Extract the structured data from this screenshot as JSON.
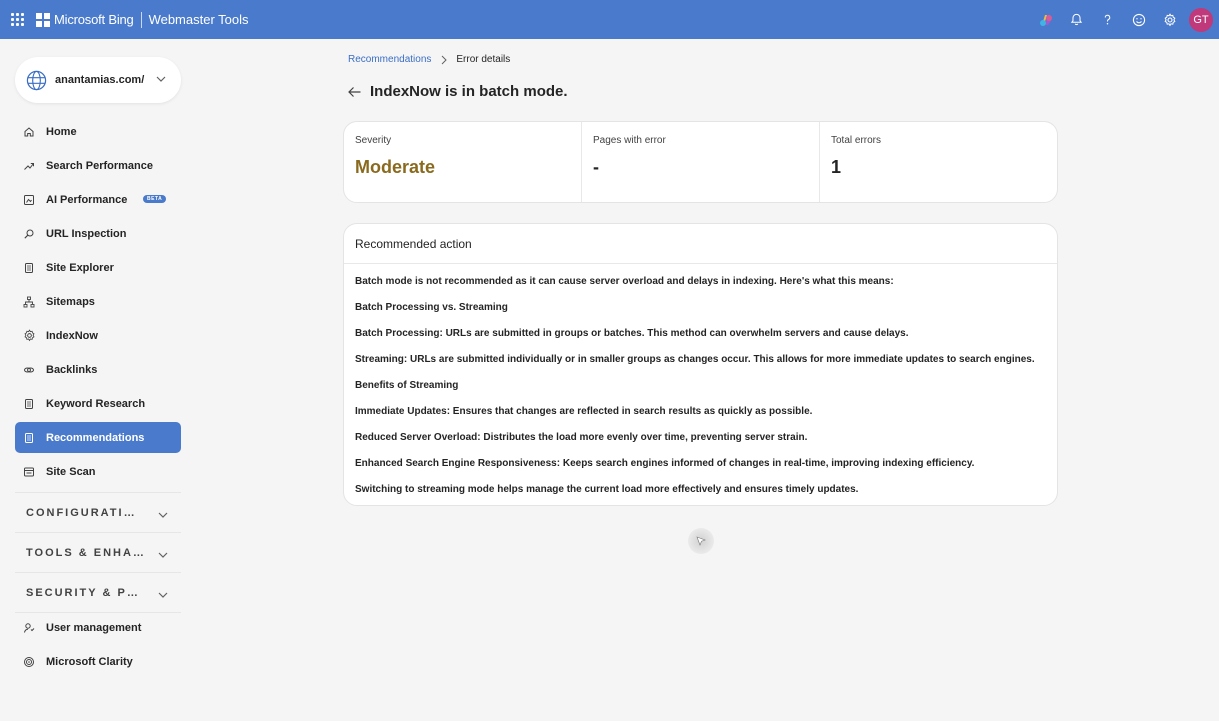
{
  "topbar": {
    "brand": "Microsoft Bing",
    "product": "Webmaster Tools",
    "avatar_initials": "GT",
    "icons": [
      "copilot-icon",
      "bell-icon",
      "help-icon",
      "feedback-icon",
      "gear-icon"
    ]
  },
  "site_picker": {
    "site": "anantamias.com/"
  },
  "sidebar": {
    "items": [
      {
        "label": "Home",
        "icon": "home-icon"
      },
      {
        "label": "Search Performance",
        "icon": "trend-icon"
      },
      {
        "label": "AI Performance",
        "icon": "ai-icon",
        "badge": "BETA"
      },
      {
        "label": "URL Inspection",
        "icon": "search-icon"
      },
      {
        "label": "Site Explorer",
        "icon": "document-icon"
      },
      {
        "label": "Sitemaps",
        "icon": "sitemap-icon"
      },
      {
        "label": "IndexNow",
        "icon": "gear-icon"
      },
      {
        "label": "Backlinks",
        "icon": "link-icon"
      },
      {
        "label": "Keyword Research",
        "icon": "document-icon"
      },
      {
        "label": "Recommendations",
        "icon": "document-icon",
        "active": true
      },
      {
        "label": "Site Scan",
        "icon": "scan-icon"
      }
    ],
    "groups": [
      "CONFIGURATION",
      "TOOLS & ENHANCEMENTS",
      "SECURITY & PRIVACY"
    ],
    "bottom_items": [
      {
        "label": "User management",
        "icon": "user-icon"
      },
      {
        "label": "Microsoft Clarity",
        "icon": "clarity-icon"
      }
    ]
  },
  "breadcrumb": {
    "parent": "Recommendations",
    "current": "Error details"
  },
  "page_title": "IndexNow is in batch mode.",
  "stats": [
    {
      "label": "Severity",
      "value": "Moderate"
    },
    {
      "label": "Pages with error",
      "value": "-"
    },
    {
      "label": "Total errors",
      "value": "1"
    }
  ],
  "action": {
    "heading": "Recommended action",
    "lines": [
      "Batch mode is not recommended as it can cause server overload and delays in indexing. Here's what this means:",
      "Batch Processing vs. Streaming",
      "Batch Processing: URLs are submitted in groups or batches. This method can overwhelm servers and cause delays.",
      "Streaming: URLs are submitted individually or in smaller groups as changes occur. This allows for more immediate updates to search engines.",
      "Benefits of Streaming",
      "Immediate Updates: Ensures that changes are reflected in search results as quickly as possible.",
      "Reduced Server Overload: Distributes the load more evenly over time, preventing server strain.",
      "Enhanced Search Engine Responsiveness: Keeps search engines informed of changes in real-time, improving indexing efficiency.",
      "Switching to streaming mode helps manage the current load more effectively and ensures timely updates."
    ]
  },
  "colors": {
    "accent": "#4a7acb",
    "moderate": "#8a6a1e",
    "link": "#3a6ec4"
  }
}
